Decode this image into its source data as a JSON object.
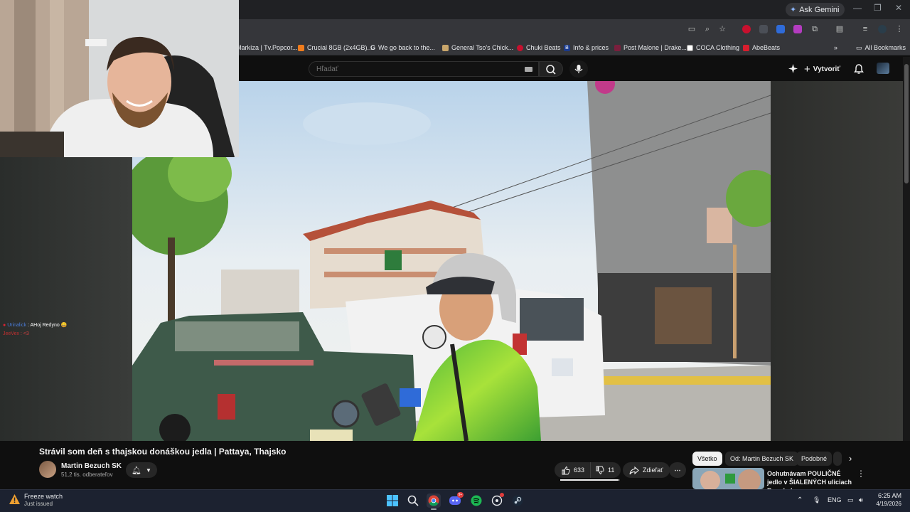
{
  "browser": {
    "ask_gemini": "Ask Gemini",
    "bookmarks": [
      {
        "label": "Markíza | Tv.Popcor...",
        "color": "#e8eaed"
      },
      {
        "label": "Crucial 8GB (2x4GB)...",
        "color": "#f07c1c"
      },
      {
        "label": "We go back to the...",
        "color": "#ffffff"
      },
      {
        "label": "General Tso's Chick...",
        "color": "#c9a66b"
      },
      {
        "label": "Chuki Beats",
        "color": "#c8102e"
      },
      {
        "label": "Info & prices",
        "color": "#1a3a8c"
      },
      {
        "label": "Post Malone | Drake...",
        "color": "#7a1f3d"
      },
      {
        "label": "COCA Clothing",
        "color": "#ffffff"
      },
      {
        "label": "AbeBeats",
        "color": "#d91e2e"
      }
    ],
    "all_bookmarks": "All Bookmarks"
  },
  "youtube": {
    "search_placeholder": "Hľadať",
    "create_label": "Vytvoriť",
    "video": {
      "title": "Strávil som deň s thajskou donáškou jedla | Pattaya, Thajsko",
      "channel": "Martin Bezuch SK",
      "subscribers": "51,2 tis. odberateľov",
      "likes": "633",
      "dislikes": "11",
      "like_ratio": 0.98,
      "share_label": "Zdieľať"
    },
    "chips": [
      "Všetko",
      "Od: Martin Bezuch SK",
      "Podobné"
    ],
    "recommended": {
      "title": "Ochutnávam POULIČNÉ jedlo v ŠIALENÝCH uliciach Bangkok..."
    }
  },
  "stream_chat": [
    {
      "user": "Urinalick",
      "message": ": AHoj Redyno",
      "user_color": "#4a7bd6"
    },
    {
      "user": "JeeVex",
      "message": ": <3",
      "user_color": "#c33030"
    }
  ],
  "taskbar": {
    "notification_title": "Freeze watch",
    "notification_sub": "Just issued",
    "language": "ENG",
    "time": "6:25 AM",
    "date": "4/19/2026"
  },
  "colors": {
    "youtube_bg": "#0f0f0f",
    "chrome_bg": "#35363a",
    "taskbar_bg": "#1c2230",
    "delivery_jacket": "#6ad02a"
  },
  "icons": [
    "chrome-icon",
    "discord-icon",
    "spotify-icon",
    "steam-icon",
    "windows-start-icon",
    "search-icon",
    "bell-icon",
    "mic-icon",
    "like-icon",
    "dislike-icon",
    "share-icon"
  ]
}
